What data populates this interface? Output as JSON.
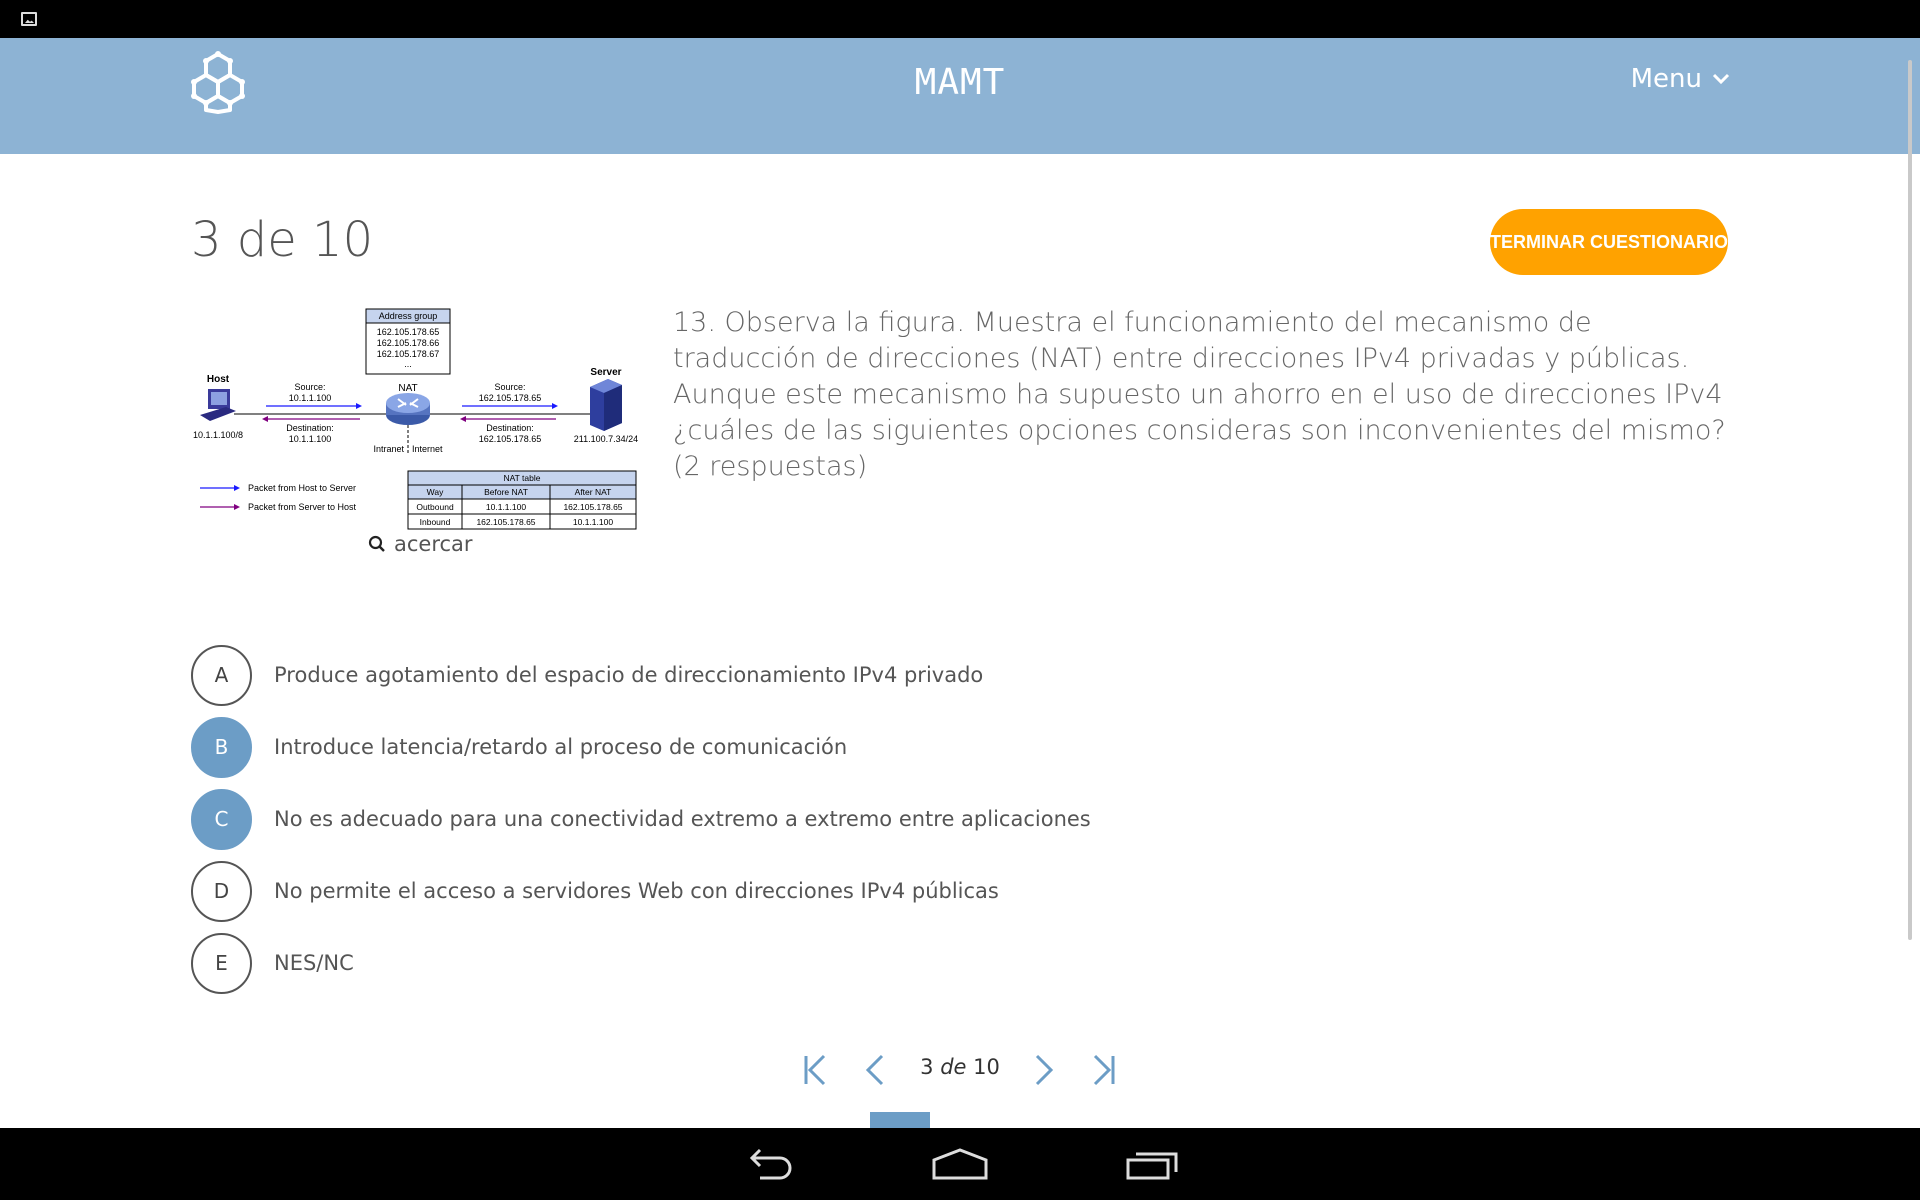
{
  "app": {
    "title": "MAMT",
    "menu_label": "Menu"
  },
  "quiz": {
    "progress_current": "3",
    "progress_sep": "de",
    "progress_total": "10",
    "progress_title": "3 de 10",
    "finish_label": "TERMINAR CUESTIONARIO",
    "zoom_label": "acercar",
    "question": "13. Observa la figura. Muestra el funcionamiento del mecanismo de traducción de direcciones (NAT) entre direcciones IPv4 privadas y públicas. Aunque este mecanismo ha supuesto un ahorro en el uso de direcciones IPv4 ¿cuáles de las siguientes opciones consideras son inconvenientes del mismo? (2 respuestas)",
    "options": [
      {
        "letter": "A",
        "text": "Produce agotamiento del espacio de direccionamiento IPv4 privado",
        "selected": false
      },
      {
        "letter": "B",
        "text": "Introduce latencia/retardo al proceso de comunicación",
        "selected": true
      },
      {
        "letter": "C",
        "text": "No es adecuado para una conectividad extremo a extremo entre aplicaciones",
        "selected": true
      },
      {
        "letter": "D",
        "text": "No permite el acceso a servidores Web con direcciones IPv4 públicas",
        "selected": false
      },
      {
        "letter": "E",
        "text": "NES/NC",
        "selected": false
      }
    ]
  },
  "figure": {
    "address_group_title": "Address group",
    "address_group": [
      "162.105.178.65",
      "162.105.178.66",
      "162.105.178.67",
      "..."
    ],
    "host_label": "Host",
    "host_ip": "10.1.1.100/8",
    "nat_label": "NAT",
    "server_label": "Server",
    "server_ip": "211.100.7.34/24",
    "left_src": "Source:",
    "left_src_ip": "10.1.1.100",
    "left_dst": "Destination:",
    "left_dst_ip": "10.1.1.100",
    "right_src": "Source:",
    "right_src_ip": "162.105.178.65",
    "right_dst": "Destination:",
    "right_dst_ip": "162.105.178.65",
    "intranet": "Intranet",
    "internet": "Internet",
    "legend_1": "Packet from Host to Server",
    "legend_2": "Packet from Server to Host",
    "nat_table_title": "NAT table",
    "nat_table_headers": [
      "Way",
      "Before NAT",
      "After NAT"
    ],
    "nat_table_rows": [
      [
        "Outbound",
        "10.1.1.100",
        "162.105.178.65"
      ],
      [
        "Inbound",
        "162.105.178.65",
        "10.1.1.100"
      ]
    ]
  },
  "colors": {
    "header": "#8db3d4",
    "accent": "#6c9dc6",
    "finish": "#ffa200",
    "arrow_out": "#1a1aff",
    "arrow_in": "#800080"
  },
  "icons": {
    "status": "image-notification-icon",
    "logo": "hexagon-logo-icon",
    "menu": "chevron-down-icon",
    "zoom": "search-icon"
  }
}
